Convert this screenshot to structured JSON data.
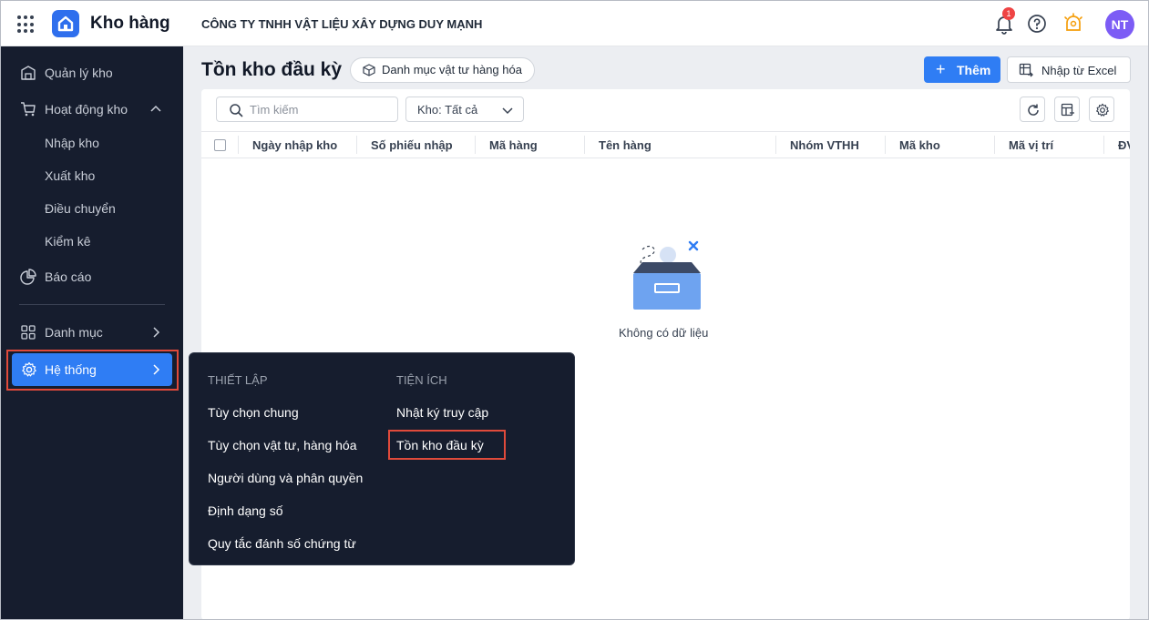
{
  "app": {
    "name": "Kho hàng",
    "company": "CÔNG TY TNHH VẬT LIỆU XÂY DỰNG DUY MẠNH"
  },
  "header": {
    "notification_count": "1",
    "avatar_initials": "NT",
    "icons": [
      "apps-icon",
      "bell-icon",
      "help-icon",
      "idea-icon"
    ]
  },
  "sidebar": {
    "items": [
      {
        "label": "Quản lý kho",
        "icon": "warehouse-icon"
      },
      {
        "label": "Hoạt động kho",
        "icon": "cart-icon",
        "expanded": true,
        "children": [
          "Nhập kho",
          "Xuất kho",
          "Điều chuyển",
          "Kiểm kê"
        ]
      },
      {
        "label": "Báo cáo",
        "icon": "pie-chart-icon"
      },
      {
        "label": "Danh mục",
        "icon": "grid-icon"
      },
      {
        "label": "Hệ thống",
        "icon": "gear-icon",
        "active": true
      }
    ]
  },
  "page": {
    "title": "Tồn kho đầu kỳ",
    "category_button": "Danh mục vật tư hàng hóa",
    "add_button": "Thêm",
    "import_button": "Nhập từ Excel"
  },
  "toolbar": {
    "search_placeholder": "Tìm kiếm",
    "warehouse_filter": "Kho: Tất cả"
  },
  "table": {
    "columns": [
      "Ngày nhập kho",
      "Số phiếu nhập",
      "Mã hàng",
      "Tên hàng",
      "Nhóm VTHH",
      "Mã kho",
      "Mã vị trí",
      "ĐV"
    ],
    "empty_text": "Không có dữ liệu"
  },
  "menu": {
    "sections": [
      {
        "title": "THIẾT LẬP",
        "items": [
          "Tùy chọn chung",
          "Tùy chọn vật tư, hàng hóa",
          "Người dùng và phân quyền",
          "Định dạng số",
          "Quy tắc đánh số chứng từ"
        ]
      },
      {
        "title": "TIỆN ÍCH",
        "items": [
          "Nhật ký truy cập",
          "Tồn kho đầu kỳ"
        ]
      }
    ]
  },
  "colors": {
    "primary": "#2f7df4",
    "sidebar_bg": "#161d2e",
    "highlight": "#e04a3b",
    "avatar": "#7c5cf5"
  }
}
